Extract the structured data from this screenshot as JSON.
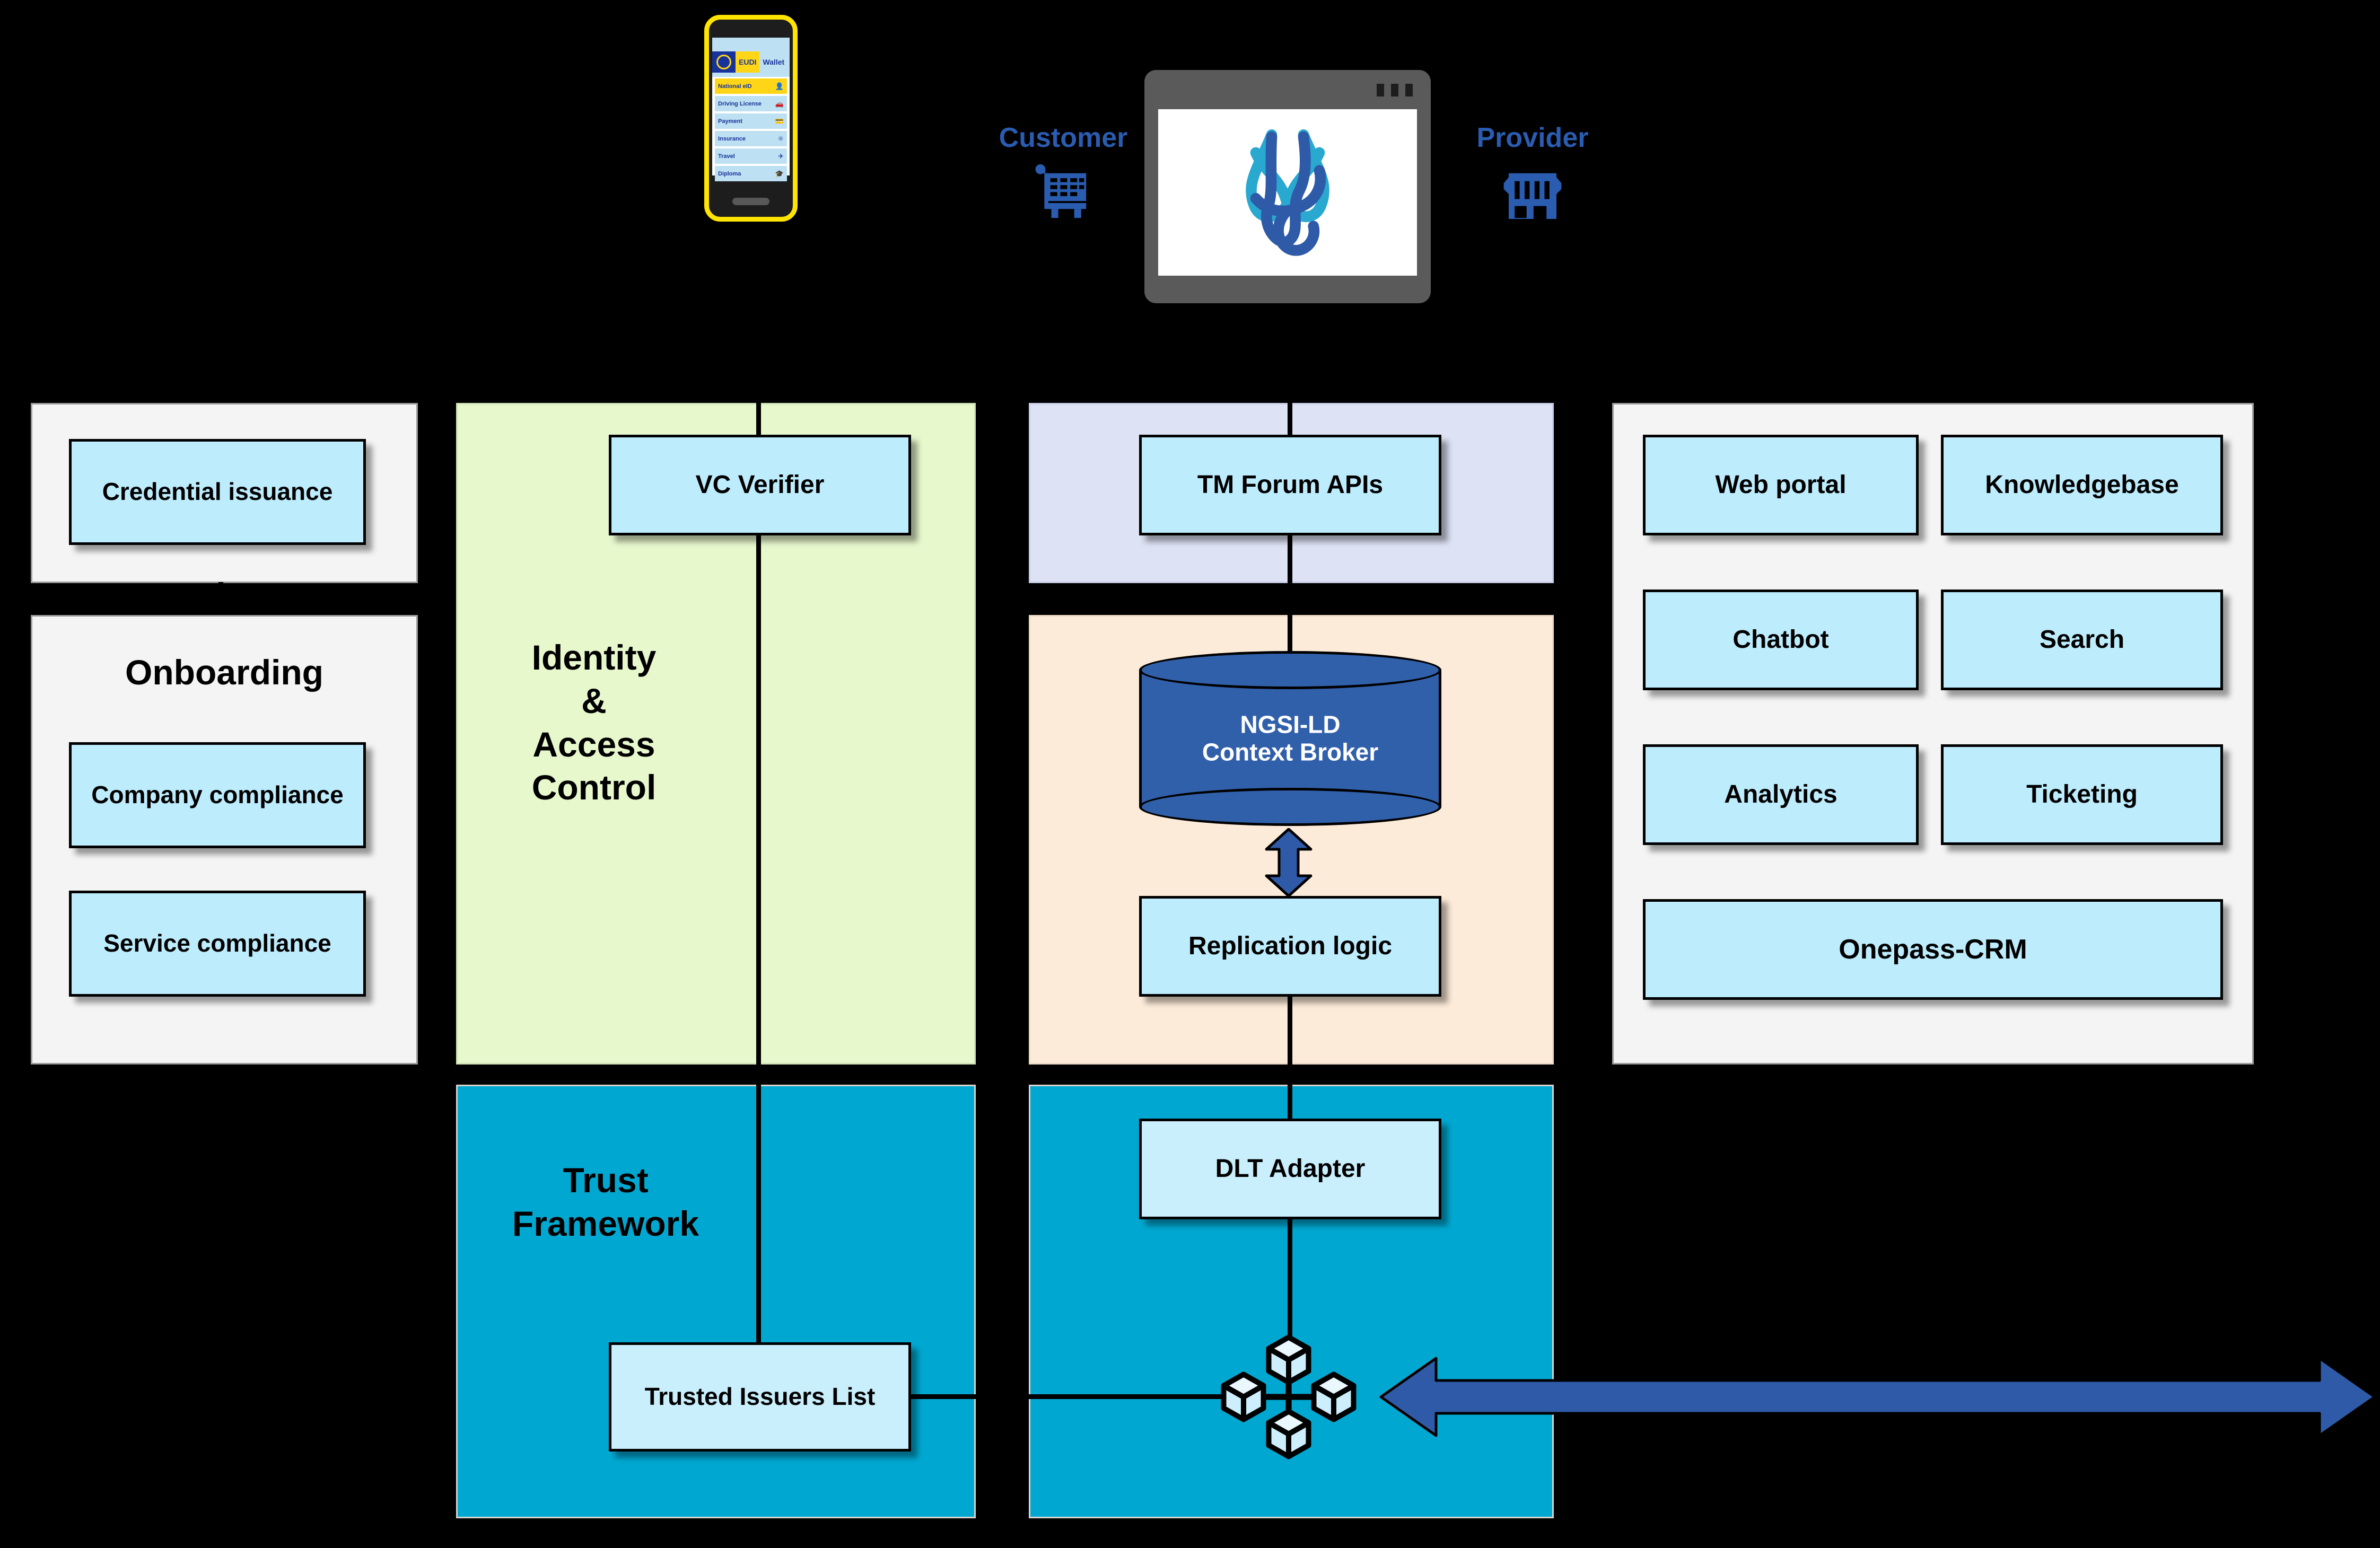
{
  "wallet": {
    "brand_eu": "EU",
    "brand_eudi": "EUDI",
    "brand_wallet": "Wallet",
    "items": [
      {
        "label": "National eID",
        "icon": "id-card-icon",
        "highlight": true
      },
      {
        "label": "Driving License",
        "icon": "driving-license-icon",
        "highlight": false
      },
      {
        "label": "Payment",
        "icon": "payment-card-icon",
        "highlight": false
      },
      {
        "label": "Insurance",
        "icon": "insurance-shield-icon",
        "highlight": false
      },
      {
        "label": "Travel",
        "icon": "travel-icon",
        "highlight": false
      },
      {
        "label": "Diploma",
        "icon": "diploma-icon",
        "highlight": false
      }
    ]
  },
  "actors": {
    "customer_label": "Customer",
    "customer_icon": "shopping-cart-icon",
    "provider_label": "Provider",
    "provider_icon": "shop-storefront-icon",
    "browser_logo": "dataspace-knot-logo",
    "accent_blue": "#2a5cb0"
  },
  "columns": {
    "onboarding": {
      "credential_panel": {
        "box_label": "Credential issuance"
      },
      "onboarding_panel": {
        "title": "Onboarding",
        "boxes": [
          {
            "label": "Company compliance"
          },
          {
            "label": "Service compliance"
          }
        ]
      }
    },
    "identity": {
      "panel_title": "Identity\n&\nAccess\nControl",
      "panel_title_lines": [
        "Identity",
        "&",
        "Access",
        "Control"
      ],
      "panel_color": "#e7f8cd",
      "box_label": "VC Verifier",
      "trust": {
        "title_lines": [
          "Trust",
          "Framework"
        ],
        "panel_color": "#00a8d1",
        "box_label": "Trusted Issuers List"
      }
    },
    "data": {
      "api_panel": {
        "box_label": "TM Forum APIs",
        "panel_color": "#dde2f4"
      },
      "broker_panel": {
        "panel_color": "#fdebd9",
        "cylinder_label_lines": [
          "NGSI-LD",
          "Context Broker"
        ],
        "cylinder_color": "#3160ab",
        "box_label": "Replication logic"
      },
      "dlt_panel": {
        "panel_color": "#00a8d1",
        "box_label": "DLT Adapter",
        "network_icon": "blockchain-network-icon"
      }
    },
    "services": {
      "boxes": [
        {
          "label": "Web portal"
        },
        {
          "label": "Knowledgebase"
        },
        {
          "label": "Chatbot"
        },
        {
          "label": "Search"
        },
        {
          "label": "Analytics"
        },
        {
          "label": "Ticketing"
        },
        {
          "label": "Onepass-CRM"
        }
      ]
    }
  },
  "arrows": {
    "broker_replication": "bidirectional-vertical-arrow",
    "dlt_external": "bidirectional-horizontal-arrow",
    "arrow_color": "#2f5aa8"
  },
  "theme": {
    "box_fill": "#bdecfd",
    "panel_gray": "#f4f4f4",
    "background": "#000000"
  }
}
